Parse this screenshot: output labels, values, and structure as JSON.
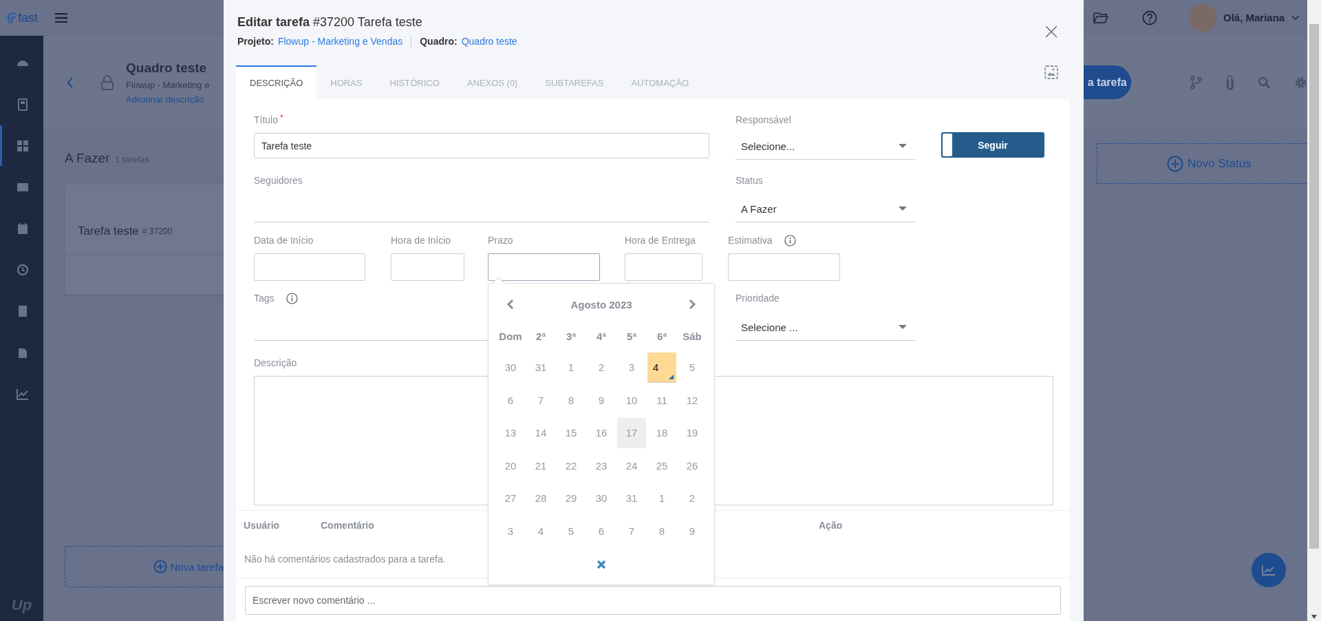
{
  "app": {
    "logo": "fast",
    "footer_logo": "Up",
    "sidebar_items": [
      {
        "selected": false
      },
      {
        "selected": false
      },
      {
        "selected": true
      },
      {
        "selected": false
      },
      {
        "selected": false
      },
      {
        "selected": false
      },
      {
        "selected": false
      },
      {
        "selected": false
      },
      {
        "selected": false
      }
    ],
    "user_greeting": "Olá, Mariana"
  },
  "board": {
    "title": "Quadro teste",
    "subtitle": "Flowup - Marketing e",
    "add_description": "Adicionar descrição",
    "primary_button": "a tarefa",
    "column": {
      "name": "A Fazer",
      "count": "1 tarefas",
      "card": {
        "title": "Tarefa teste",
        "number": "# 37200"
      },
      "add_task": "Nova tarefa"
    },
    "new_status": "Novo Status"
  },
  "modal": {
    "title_bold": "Editar tarefa",
    "title_rest": "#37200 Tarefa teste",
    "project_label": "Projeto:",
    "project": "Flowup - Marketing e Vendas",
    "board_label": "Quadro:",
    "board": "Quadro teste",
    "tabs": [
      {
        "label": "DESCRIÇÃO",
        "selected": true
      },
      {
        "label": "HORAS",
        "selected": false
      },
      {
        "label": "HISTÓRICO",
        "selected": false
      },
      {
        "label": "ANEXOS (0)",
        "selected": false
      },
      {
        "label": "SUBTAREFAS",
        "selected": false
      },
      {
        "label": "AUTOMAÇÃO",
        "selected": false
      }
    ],
    "title_field": {
      "label": "Título",
      "required_mark": "*",
      "value": "Tarefa teste"
    },
    "responsible": {
      "label": "Responsável",
      "value": "Selecione..."
    },
    "follow_button": "Seguir",
    "followers": {
      "label": "Seguidores"
    },
    "status": {
      "label": "Status",
      "value": "A Fazer"
    },
    "date_fields": [
      {
        "label": "Data de Início",
        "info": false,
        "open": false
      },
      {
        "label": "Hora de Início",
        "info": false,
        "open": false
      },
      {
        "label": "Prazo",
        "info": false,
        "open": true
      },
      {
        "label": "Hora de Entrega",
        "info": false,
        "open": false
      },
      {
        "label": "Estimativa",
        "info": true,
        "open": false
      }
    ],
    "tags": {
      "label": "Tags",
      "info": true
    },
    "priority": {
      "label": "Prioridade",
      "value": "Selecione ..."
    },
    "description": {
      "label": "Descrição"
    },
    "datepicker": {
      "month": "Agosto 2023",
      "weekdays": [
        "Dom",
        "2ª",
        "3ª",
        "4ª",
        "5ª",
        "6ª",
        "Sáb"
      ],
      "weeks": [
        [
          {
            "day": "30",
            "selected": false,
            "today": false
          },
          {
            "day": "31",
            "selected": false,
            "today": false
          },
          {
            "day": "1",
            "selected": false,
            "today": false
          },
          {
            "day": "2",
            "selected": false,
            "today": false
          },
          {
            "day": "3",
            "selected": false,
            "today": false
          },
          {
            "day": "4",
            "selected": true,
            "today": false
          },
          {
            "day": "5",
            "selected": false,
            "today": false
          }
        ],
        [
          {
            "day": "6",
            "selected": false,
            "today": false
          },
          {
            "day": "7",
            "selected": false,
            "today": false
          },
          {
            "day": "8",
            "selected": false,
            "today": false
          },
          {
            "day": "9",
            "selected": false,
            "today": false
          },
          {
            "day": "10",
            "selected": false,
            "today": false
          },
          {
            "day": "11",
            "selected": false,
            "today": false
          },
          {
            "day": "12",
            "selected": false,
            "today": false
          }
        ],
        [
          {
            "day": "13",
            "selected": false,
            "today": false
          },
          {
            "day": "14",
            "selected": false,
            "today": false
          },
          {
            "day": "15",
            "selected": false,
            "today": false
          },
          {
            "day": "16",
            "selected": false,
            "today": false
          },
          {
            "day": "17",
            "selected": false,
            "today": true
          },
          {
            "day": "18",
            "selected": false,
            "today": false
          },
          {
            "day": "19",
            "selected": false,
            "today": false
          }
        ],
        [
          {
            "day": "20",
            "selected": false,
            "today": false
          },
          {
            "day": "21",
            "selected": false,
            "today": false
          },
          {
            "day": "22",
            "selected": false,
            "today": false
          },
          {
            "day": "23",
            "selected": false,
            "today": false
          },
          {
            "day": "24",
            "selected": false,
            "today": false
          },
          {
            "day": "25",
            "selected": false,
            "today": false
          },
          {
            "day": "26",
            "selected": false,
            "today": false
          }
        ],
        [
          {
            "day": "27",
            "selected": false,
            "today": false
          },
          {
            "day": "28",
            "selected": false,
            "today": false
          },
          {
            "day": "29",
            "selected": false,
            "today": false
          },
          {
            "day": "30",
            "selected": false,
            "today": false
          },
          {
            "day": "31",
            "selected": false,
            "today": false
          },
          {
            "day": "1",
            "selected": false,
            "today": false
          },
          {
            "day": "2",
            "selected": false,
            "today": false
          }
        ],
        [
          {
            "day": "3",
            "selected": false,
            "today": false
          },
          {
            "day": "4",
            "selected": false,
            "today": false
          },
          {
            "day": "5",
            "selected": false,
            "today": false
          },
          {
            "day": "6",
            "selected": false,
            "today": false
          },
          {
            "day": "7",
            "selected": false,
            "today": false
          },
          {
            "day": "8",
            "selected": false,
            "today": false
          },
          {
            "day": "9",
            "selected": false,
            "today": false
          }
        ]
      ]
    },
    "comments": {
      "columns": [
        "Usuário",
        "Comentário",
        "Ação"
      ],
      "empty_text": "Não há comentários cadastrados para a tarefa.",
      "placeholder": "Escrever novo comentário ..."
    }
  }
}
